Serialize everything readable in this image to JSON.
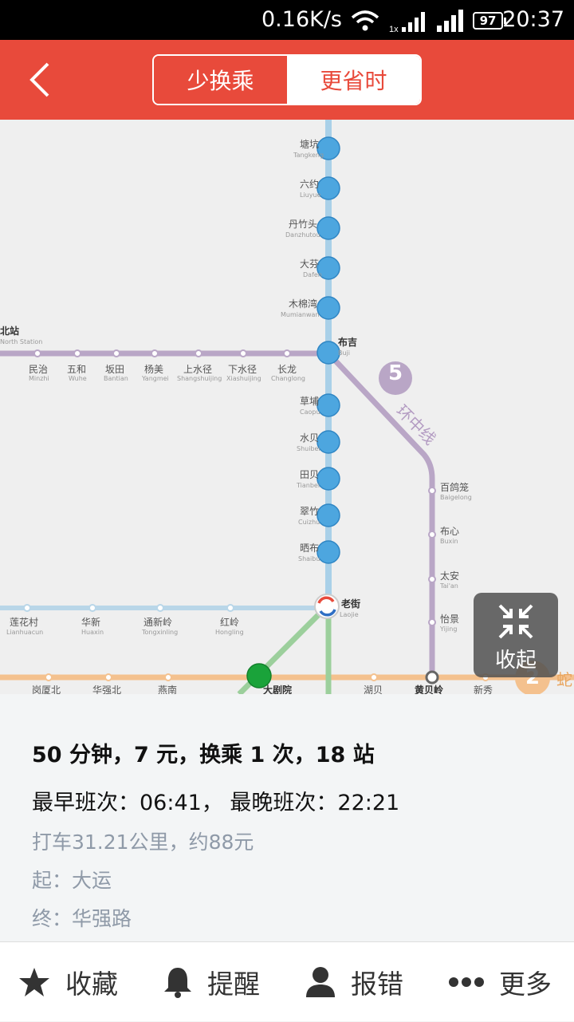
{
  "status_bar": {
    "network_speed": "0.16K/s",
    "battery": "97",
    "time": "20:37"
  },
  "header": {
    "tab_less_transfer": "少换乘",
    "tab_less_time": "更省时"
  },
  "map": {
    "main_line_stations": [
      {
        "name": "塘坑",
        "pinyin": "Tangkeng"
      },
      {
        "name": "六约",
        "pinyin": "Liuyue"
      },
      {
        "name": "丹竹头",
        "pinyin": "Danzhutou"
      },
      {
        "name": "大芬",
        "pinyin": "Dafen"
      },
      {
        "name": "木棉湾",
        "pinyin": "Mumianwan"
      },
      {
        "name": "布吉",
        "pinyin": "Buji"
      },
      {
        "name": "草埔",
        "pinyin": "Caopu"
      },
      {
        "name": "水贝",
        "pinyin": "Shuibei"
      },
      {
        "name": "田贝",
        "pinyin": "Tianbei"
      },
      {
        "name": "翠竹",
        "pinyin": "Cuizhu"
      },
      {
        "name": "晒布",
        "pinyin": "Shaibu"
      },
      {
        "name": "老街",
        "pinyin": "Laojie"
      }
    ],
    "line5_stations": [
      {
        "name": "民治",
        "pinyin": "Minzhi"
      },
      {
        "name": "五和",
        "pinyin": "Wuhe"
      },
      {
        "name": "坂田",
        "pinyin": "Bantian"
      },
      {
        "name": "杨美",
        "pinyin": "Yangmei"
      },
      {
        "name": "上水径",
        "pinyin": "Shangshuijing"
      },
      {
        "name": "下水径",
        "pinyin": "Xiashuijing"
      },
      {
        "name": "长龙",
        "pinyin": "Changlong"
      }
    ],
    "line5_east_stations": [
      {
        "name": "百鸽笼",
        "pinyin": "Baigelong"
      },
      {
        "name": "布心",
        "pinyin": "Buxin"
      },
      {
        "name": "太安",
        "pinyin": "Tai'an"
      },
      {
        "name": "怡景",
        "pinyin": "Yijing"
      }
    ],
    "line3_west_stations": [
      {
        "name": "莲花村",
        "pinyin": "Lianhuacun"
      },
      {
        "name": "华新",
        "pinyin": "Huaxin"
      },
      {
        "name": "通新岭",
        "pinyin": "Tongxinling"
      },
      {
        "name": "红岭",
        "pinyin": "Hongling"
      }
    ],
    "line2_stations": [
      "岗厦北",
      "华强北",
      "燕南",
      "大剧院",
      "湖贝",
      "黄贝岭",
      "新秀"
    ],
    "north_station": {
      "name": "北站",
      "pinyin": "North Station"
    },
    "line5_label": "5",
    "line5_name": "环中线",
    "line2_label": "2",
    "line2_partial": "蛇",
    "collapse_label": "收起"
  },
  "info": {
    "summary": "50 分钟，7 元，换乘 1 次，18 站",
    "schedule": "最早班次：06:41， 最晚班次：22:21",
    "taxi": "打车31.21公里，约88元",
    "start": "起：大运",
    "end": "终：华强路"
  },
  "footer": {
    "favorite": "收藏",
    "remind": "提醒",
    "report": "报错",
    "more": "更多"
  }
}
